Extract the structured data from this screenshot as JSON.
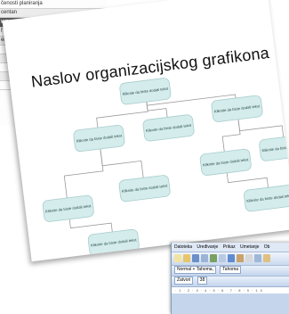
{
  "background_table": {
    "rows": [
      {
        "text": "čenosti planiranja",
        "style": "normal"
      },
      {
        "text": "centan",
        "style": "alt"
      },
      {
        "text": "uge",
        "style": "hdr"
      },
      {
        "text": "f",
        "style": "normal"
      },
      {
        "text": "eran",
        "style": "alt"
      },
      {
        "text": "",
        "style": "normal"
      },
      {
        "text": "",
        "style": "alt"
      },
      {
        "text": "",
        "style": "normal"
      },
      {
        "text": "",
        "style": "alt"
      },
      {
        "text": "",
        "style": "normal"
      }
    ]
  },
  "slide": {
    "title": "Naslov organizacijskog grafikona",
    "node_text": "Kliknite da biste dodali tekst"
  },
  "word_window": {
    "menu": [
      "Datoteka",
      "Uređivanje",
      "Prikaz",
      "Umetanje",
      "Ob"
    ],
    "style_box": "Normal + Tahoma,",
    "font_box": "Tahoma",
    "zoom_box": "Zatvori",
    "zoom_value": "38"
  },
  "colors": {
    "node_fill": "#d4ecec",
    "node_stroke": "#a8cccc",
    "connector": "#9a9a9a",
    "word_chrome": "#c5d6ec"
  }
}
